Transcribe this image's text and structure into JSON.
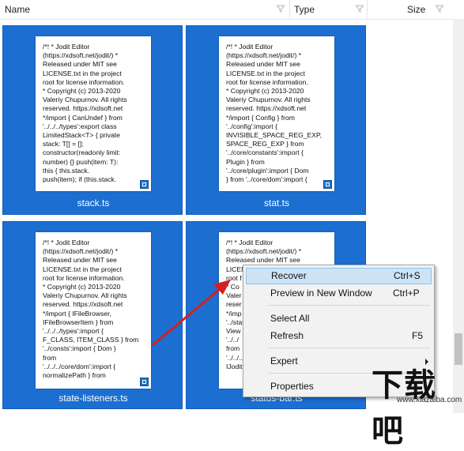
{
  "header": {
    "columns": [
      {
        "label": "Name"
      },
      {
        "label": "Type"
      },
      {
        "label": "Size"
      }
    ]
  },
  "files": [
    {
      "name": "stack.ts",
      "preview": "/*! * Jodit Editor\n(https://xdsoft.net/jodit/) *\nReleased under MIT see\nLICENSE.txt in the project\nroot for license information.\n* Copyright (c) 2013-2020\nValeriy Chupurnov. All rights\nreserved. https://xdsoft.net\n*/import { CanUndef } from\n'../../../types':export class\nLimitedStack<T> { private\nstack: T[] = [];\nconstructor(readonly limit:\nnumber) {} push(item: T):\nthis { this.stack.\npush(item); if (this.stack."
    },
    {
      "name": "stat.ts",
      "preview": "/*! * Jodit Editor\n(https://xdsoft.net/jodit/) *\nReleased under MIT see\nLICENSE.txt in the project\nroot for license information.\n* Copyright (c) 2013-2020\nValeriy Chupurnov. All rights\nreserved. https://xdsoft.net\n*/import { Config } from\n'../config':import {\nINVISIBLE_SPACE_REG_EXP,\nSPACE_REG_EXP } from\n'../core/constants':import {\nPlugin } from\n'../core/plugin':import { Dom\n} from '../core/dom':import {"
    },
    {
      "name": "state-listeners.ts",
      "preview": "/*! * Jodit Editor\n(https://xdsoft.net/jodit/) *\nReleased under MIT see\nLICENSE.txt in the project\nroot for license information.\n* Copyright (c) 2013-2020\nValeriy Chupurnov. All rights\nreserved. https://xdsoft.net\n*/import { IFileBrowser,\nIFileBrowserItem } from\n'../../../types':import {\nF_CLASS, ITEM_CLASS } from\n'../consts':import { Dom }\nfrom\n'../../../core/dom':import {\nnormalizePath } from"
    },
    {
      "name": "status-bar.ts",
      "preview": "/*! * Jodit Editor\n(https://xdsoft.net/jodit/) *\nReleased under MIT see\nLICENSE.txt in the project\nroot f\n* Co\nValer\nreser\n*/imp\n'../stat\nView\n'../../\nfrom\n'../../../\nIJodit"
    }
  ],
  "context_menu": {
    "items": [
      {
        "label": "Recover",
        "shortcut": "Ctrl+S"
      },
      {
        "label": "Preview in New Window",
        "shortcut": "Ctrl+P"
      },
      {
        "label": "Select All",
        "shortcut": ""
      },
      {
        "label": "Refresh",
        "shortcut": "F5"
      },
      {
        "label": "Expert",
        "shortcut": ""
      },
      {
        "label": "Properties",
        "shortcut": ""
      }
    ]
  },
  "watermark": {
    "brand": "下载吧",
    "url": "www.xiazaiba.com"
  },
  "colors": {
    "tile_selected": "#1c6fd1",
    "menu_highlight": "#cde4f7",
    "annotation_arrow": "#d42020"
  }
}
